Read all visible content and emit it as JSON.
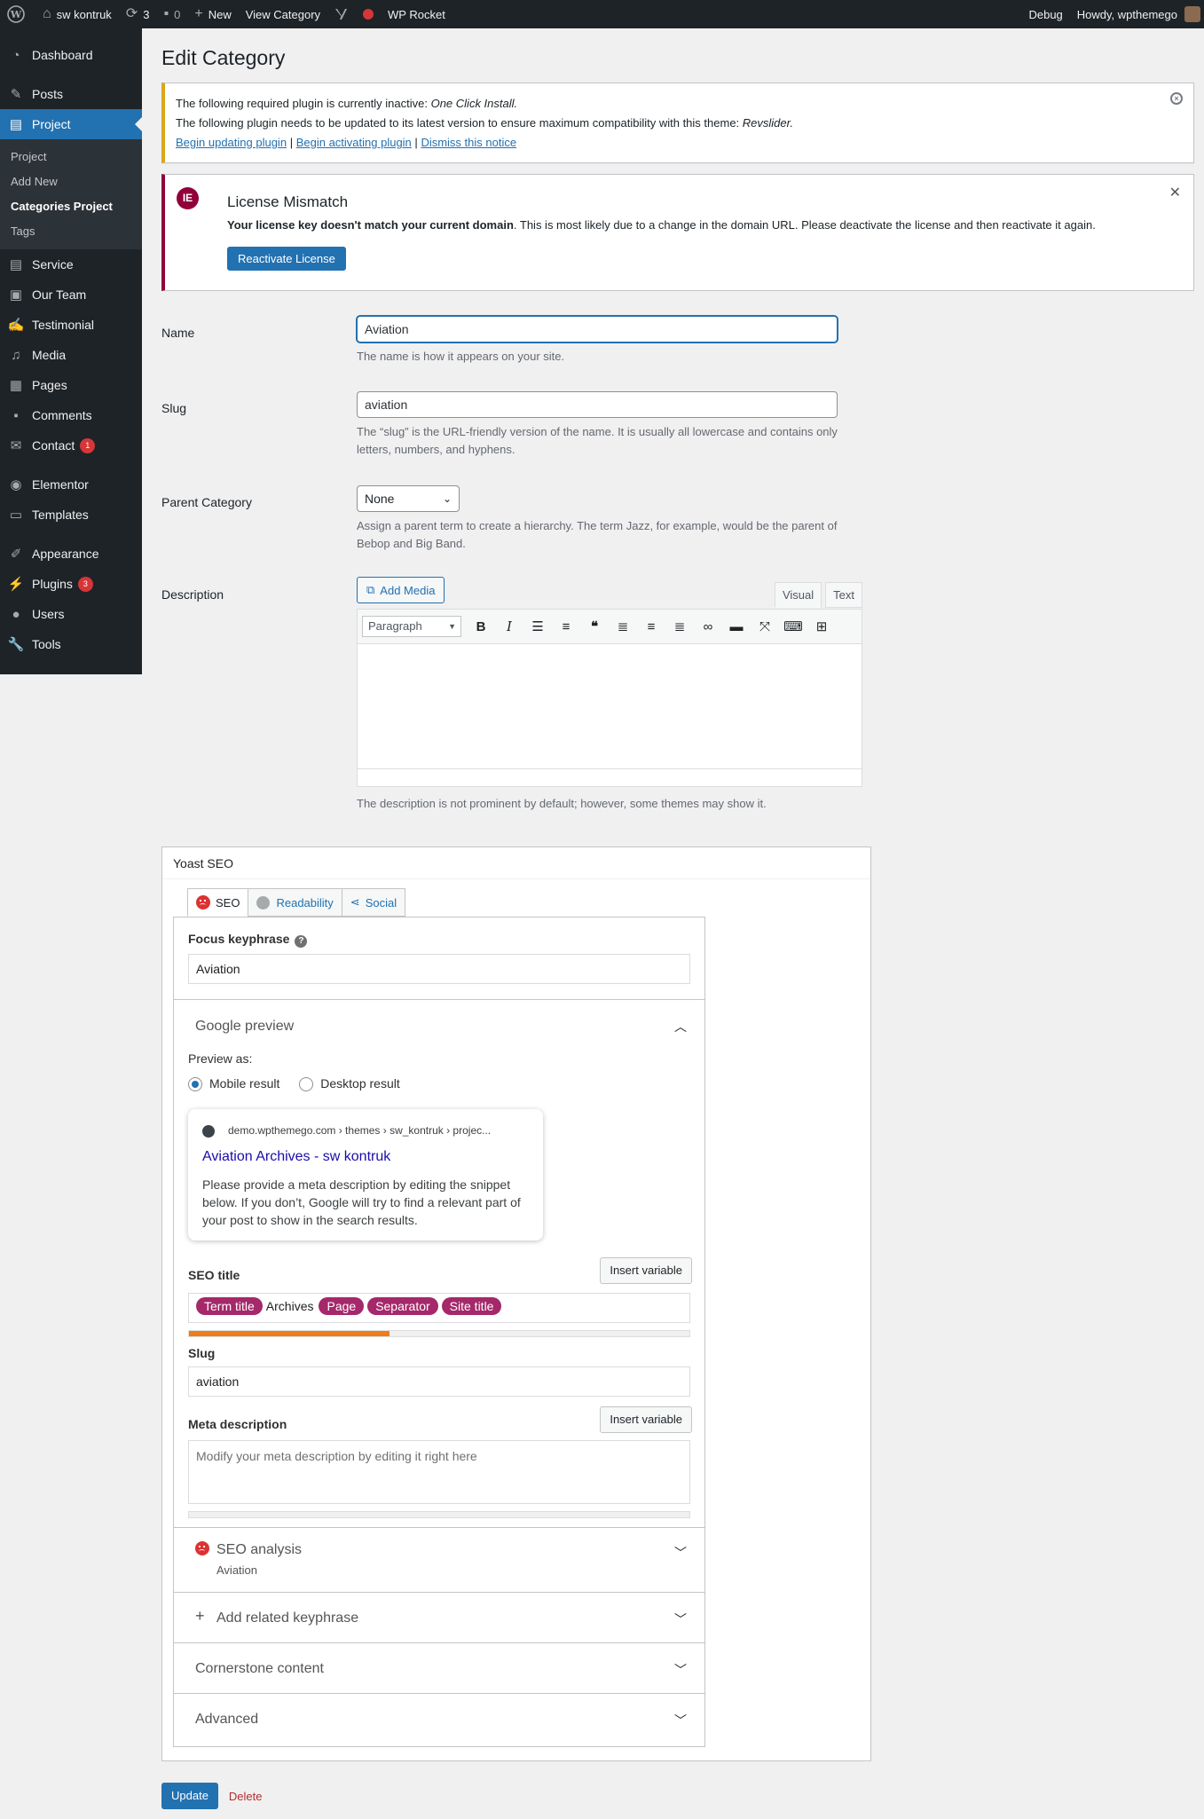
{
  "admin_bar": {
    "site_name": "sw kontruk",
    "updates_count": "3",
    "comments_count": "0",
    "new_label": "New",
    "view_label": "View Category",
    "rocket_label": "WP Rocket",
    "debug_label": "Debug",
    "howdy_label": "Howdy, wpthemego"
  },
  "sidebar": {
    "items": [
      {
        "label": "Dashboard",
        "icon": "dashboard-icon"
      },
      {
        "label": "Posts",
        "icon": "pin-icon"
      },
      {
        "label": "Project",
        "icon": "document-icon"
      },
      {
        "label": "Service",
        "icon": "document-icon"
      },
      {
        "label": "Our Team",
        "icon": "id-card-icon"
      },
      {
        "label": "Testimonial",
        "icon": "edit-icon"
      },
      {
        "label": "Media",
        "icon": "media-icon"
      },
      {
        "label": "Pages",
        "icon": "page-icon"
      },
      {
        "label": "Comments",
        "icon": "comment-icon"
      },
      {
        "label": "Contact",
        "icon": "mail-icon",
        "badge": "1"
      },
      {
        "label": "Elementor",
        "icon": "elementor-icon"
      },
      {
        "label": "Templates",
        "icon": "folder-icon"
      },
      {
        "label": "Appearance",
        "icon": "brush-icon"
      },
      {
        "label": "Plugins",
        "icon": "plugin-icon",
        "badge": "3"
      },
      {
        "label": "Users",
        "icon": "user-icon"
      },
      {
        "label": "Tools",
        "icon": "wrench-icon"
      }
    ],
    "submenu": [
      "Project",
      "Add New",
      "Categories Project",
      "Tags"
    ]
  },
  "page": {
    "title": "Edit Category"
  },
  "notice": {
    "line1_prefix": "The following required plugin is currently inactive: ",
    "line1_plugin": "One Click Install.",
    "line2_prefix": "The following plugin needs to be updated to its latest version to ensure maximum compatibility with this theme: ",
    "line2_plugin": "Revslider.",
    "link_update": "Begin updating plugin",
    "link_activate": "Begin activating plugin",
    "link_dismiss": "Dismiss this notice",
    "separator": "|"
  },
  "license": {
    "title": "License Mismatch",
    "bold_text": "Your license key doesn't match your current domain",
    "rest_text": ". This is most likely due to a change in the domain URL. Please deactivate the license and then reactivate it again.",
    "button": "Reactivate License"
  },
  "form": {
    "name_label": "Name",
    "name_value": "Aviation",
    "name_help": "The name is how it appears on your site.",
    "slug_label": "Slug",
    "slug_value": "aviation",
    "slug_help": "The “slug” is the URL-friendly version of the name. It is usually all lowercase and contains only letters, numbers, and hyphens.",
    "parent_label": "Parent Category",
    "parent_value": "None",
    "parent_help": "Assign a parent term to create a hierarchy. The term Jazz, for example, would be the parent of Bebop and Big Band.",
    "description_label": "Description",
    "add_media": "Add Media",
    "tab_visual": "Visual",
    "tab_text": "Text",
    "paragraph": "Paragraph",
    "description_help": "The description is not prominent by default; however, some themes may show it."
  },
  "yoast": {
    "title": "Yoast SEO",
    "tab_seo": "SEO",
    "tab_readability": "Readability",
    "tab_social": "Social",
    "focus_label": "Focus keyphrase",
    "focus_value": "Aviation",
    "google_preview": "Google preview",
    "preview_as": "Preview as:",
    "mobile_result": "Mobile result",
    "desktop_result": "Desktop result",
    "snippet_url": "demo.wpthemego.com › themes › sw_kontruk › projec...",
    "snippet_title": "Aviation Archives - sw kontruk",
    "snippet_desc": "Please provide a meta description by editing the snippet below. If you don’t, Google will try to find a relevant part of your post to show in the search results.",
    "seo_title_label": "SEO title",
    "insert_variable": "Insert variable",
    "seo_title_parts": [
      {
        "type": "pill",
        "text": "Term title"
      },
      {
        "type": "word",
        "text": "Archives"
      },
      {
        "type": "pill",
        "text": "Page"
      },
      {
        "type": "pill",
        "text": "Separator"
      },
      {
        "type": "pill",
        "text": "Site title"
      }
    ],
    "title_progress": 0.4,
    "slug_label": "Slug",
    "slug_value": "aviation",
    "meta_label": "Meta description",
    "meta_placeholder": "Modify your meta description by editing it right here",
    "seo_analysis": "SEO analysis",
    "seo_analysis_sub": "Aviation",
    "add_related": "Add related keyphrase",
    "cornerstone": "Cornerstone content",
    "advanced": "Advanced"
  },
  "actions": {
    "update": "Update",
    "delete": "Delete"
  },
  "colors": {
    "primary": "#2271b1",
    "sidebar": "#1d2327",
    "yoast_pill": "#a4286a",
    "warning": "#dba617",
    "elementor": "#92003b",
    "progress": "#ee7c1b"
  }
}
